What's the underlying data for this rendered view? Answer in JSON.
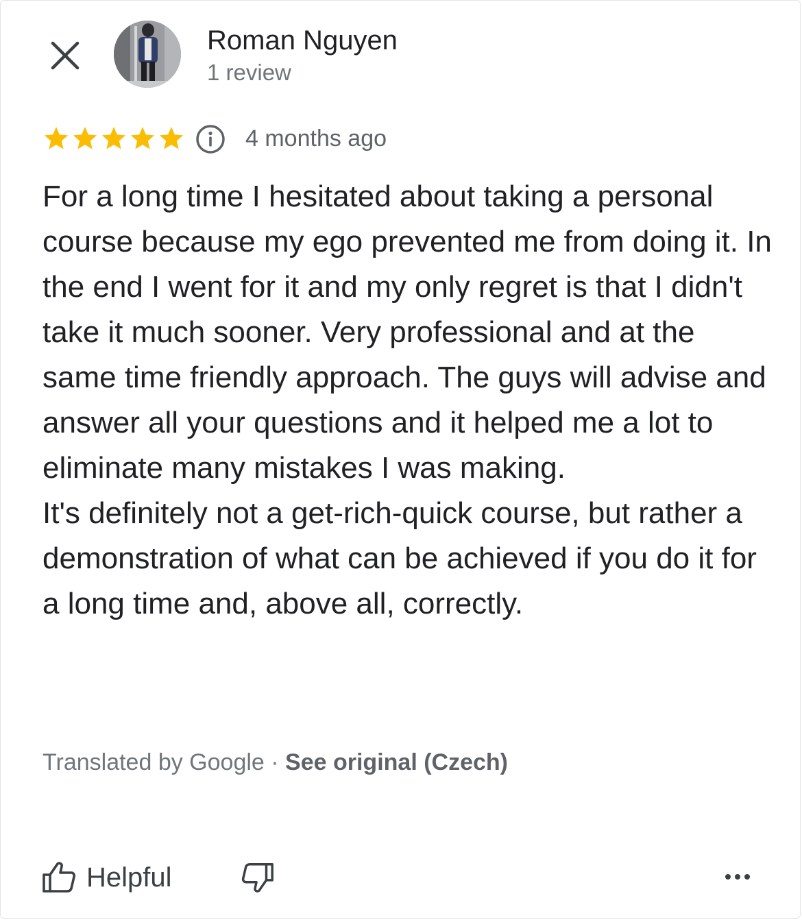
{
  "header": {
    "close_icon": "close-icon",
    "reviewer_name": "Roman Nguyen",
    "review_count": "1 review"
  },
  "meta": {
    "rating": 5,
    "max_rating": 5,
    "star_color": "#fbbc04",
    "info_icon": "info-icon",
    "date": "4 months ago"
  },
  "review": {
    "paragraphs": [
      "For a long time I hesitated about taking a personal course because my ego prevented me from doing it. In the end I went for it and my only regret is that I didn't take it much sooner. Very professional and at the same time friendly approach. The guys will advise and answer all your questions and it helped me a lot to eliminate many mistakes I was making.",
      "It's definitely not a get-rich-quick course, but rather a demonstration of what can be achieved if you do it for a long time and, above all, correctly."
    ]
  },
  "translation": {
    "prefix": "Translated by Google · ",
    "link": "See original (Czech)"
  },
  "actions": {
    "helpful_label": "Helpful",
    "thumbs_up_icon": "thumbs-up-icon",
    "thumbs_down_icon": "thumbs-down-icon",
    "more_icon": "more-horizontal-icon"
  }
}
